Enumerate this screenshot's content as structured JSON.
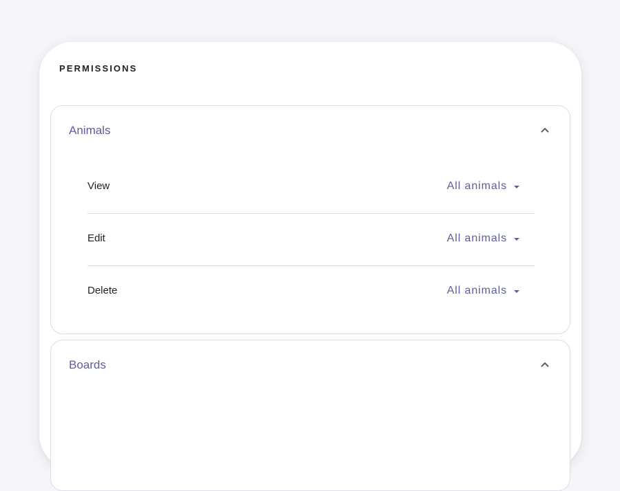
{
  "card": {
    "title": "PERMISSIONS"
  },
  "panels": [
    {
      "title": "Animals",
      "expanded": true,
      "icon": "chevron-up-icon",
      "permissions": [
        {
          "label": "View",
          "value": "All animals"
        },
        {
          "label": "Edit",
          "value": "All animals"
        },
        {
          "label": "Delete",
          "value": "All animals"
        }
      ]
    },
    {
      "title": "Boards",
      "expanded": true,
      "icon": "chevron-up-icon"
    }
  ],
  "colors": {
    "accent": "#5d5e98",
    "text": "#1f2024",
    "border": "#dcdde3",
    "background": "#f5f6fa"
  }
}
